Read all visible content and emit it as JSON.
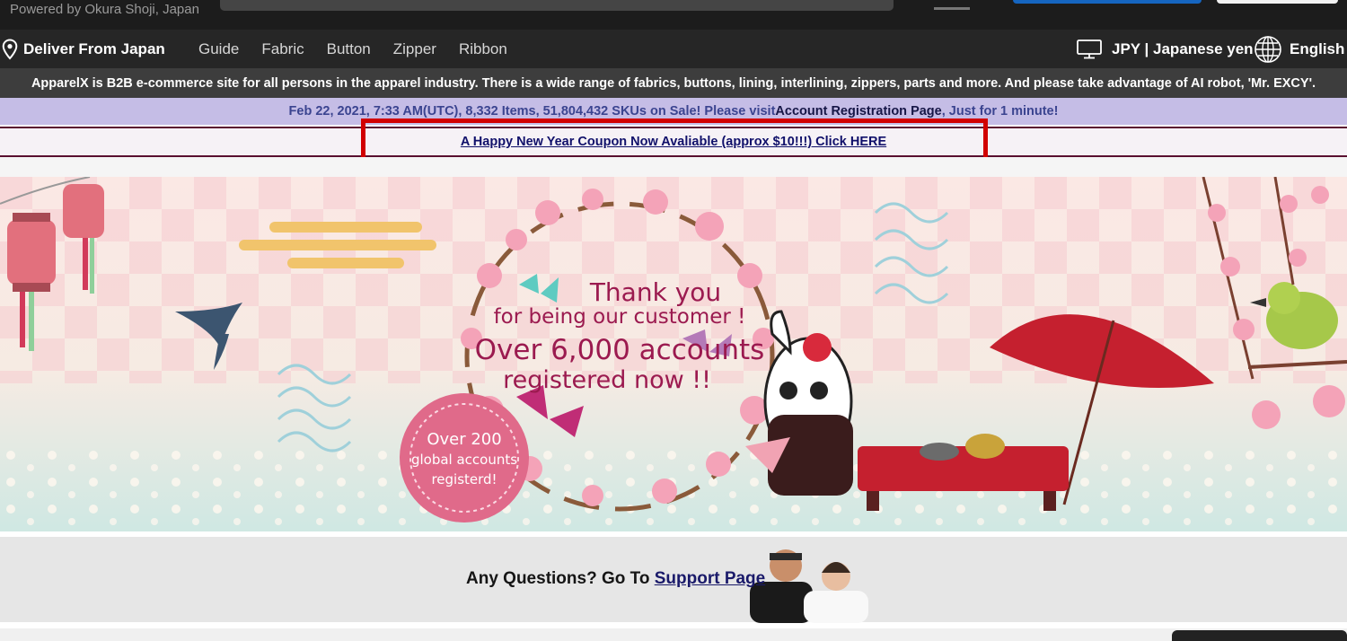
{
  "header": {
    "powered_by": "Powered by Okura Shoji, Japan"
  },
  "nav": {
    "deliver_label": "Deliver From Japan",
    "links": [
      "Guide",
      "Fabric",
      "Button",
      "Zipper",
      "Ribbon"
    ],
    "currency": "JPY | Japanese yen",
    "language": "English"
  },
  "intro_text": "ApparelX is B2B e-commerce site for all persons in the apparel industry. There is a wide range of fabrics, buttons, lining, interlining, zippers, parts and more. And please take advantage of AI robot, 'Mr. EXCY'.",
  "notice": {
    "prefix": "Feb 22, 2021, 7:33 AM(UTC), 8,332 Items, 51,804,432 SKUs on Sale! Please visit ",
    "link": "Account Registration Page",
    "suffix": ", Just for 1 minute!"
  },
  "coupon_link": "A Happy New Year Coupon Now Avaliable (approx $10!!!) Click HERE",
  "banner": {
    "line1": "Thank you",
    "line2": "for being our customer !",
    "line3": "Over 6,000 accounts",
    "line4": "registered  now !!",
    "badge_line1": "Over 200",
    "badge_line2": "global accounts",
    "badge_line3": "registerd!",
    "colors": {
      "text": "#9b1a4f",
      "checker": "#f4cdd2",
      "background_top": "#fbe6e3",
      "background_bottom": "#cfe8e3"
    }
  },
  "support": {
    "prefix": "Any Questions? Go To ",
    "link": "Support Page"
  }
}
